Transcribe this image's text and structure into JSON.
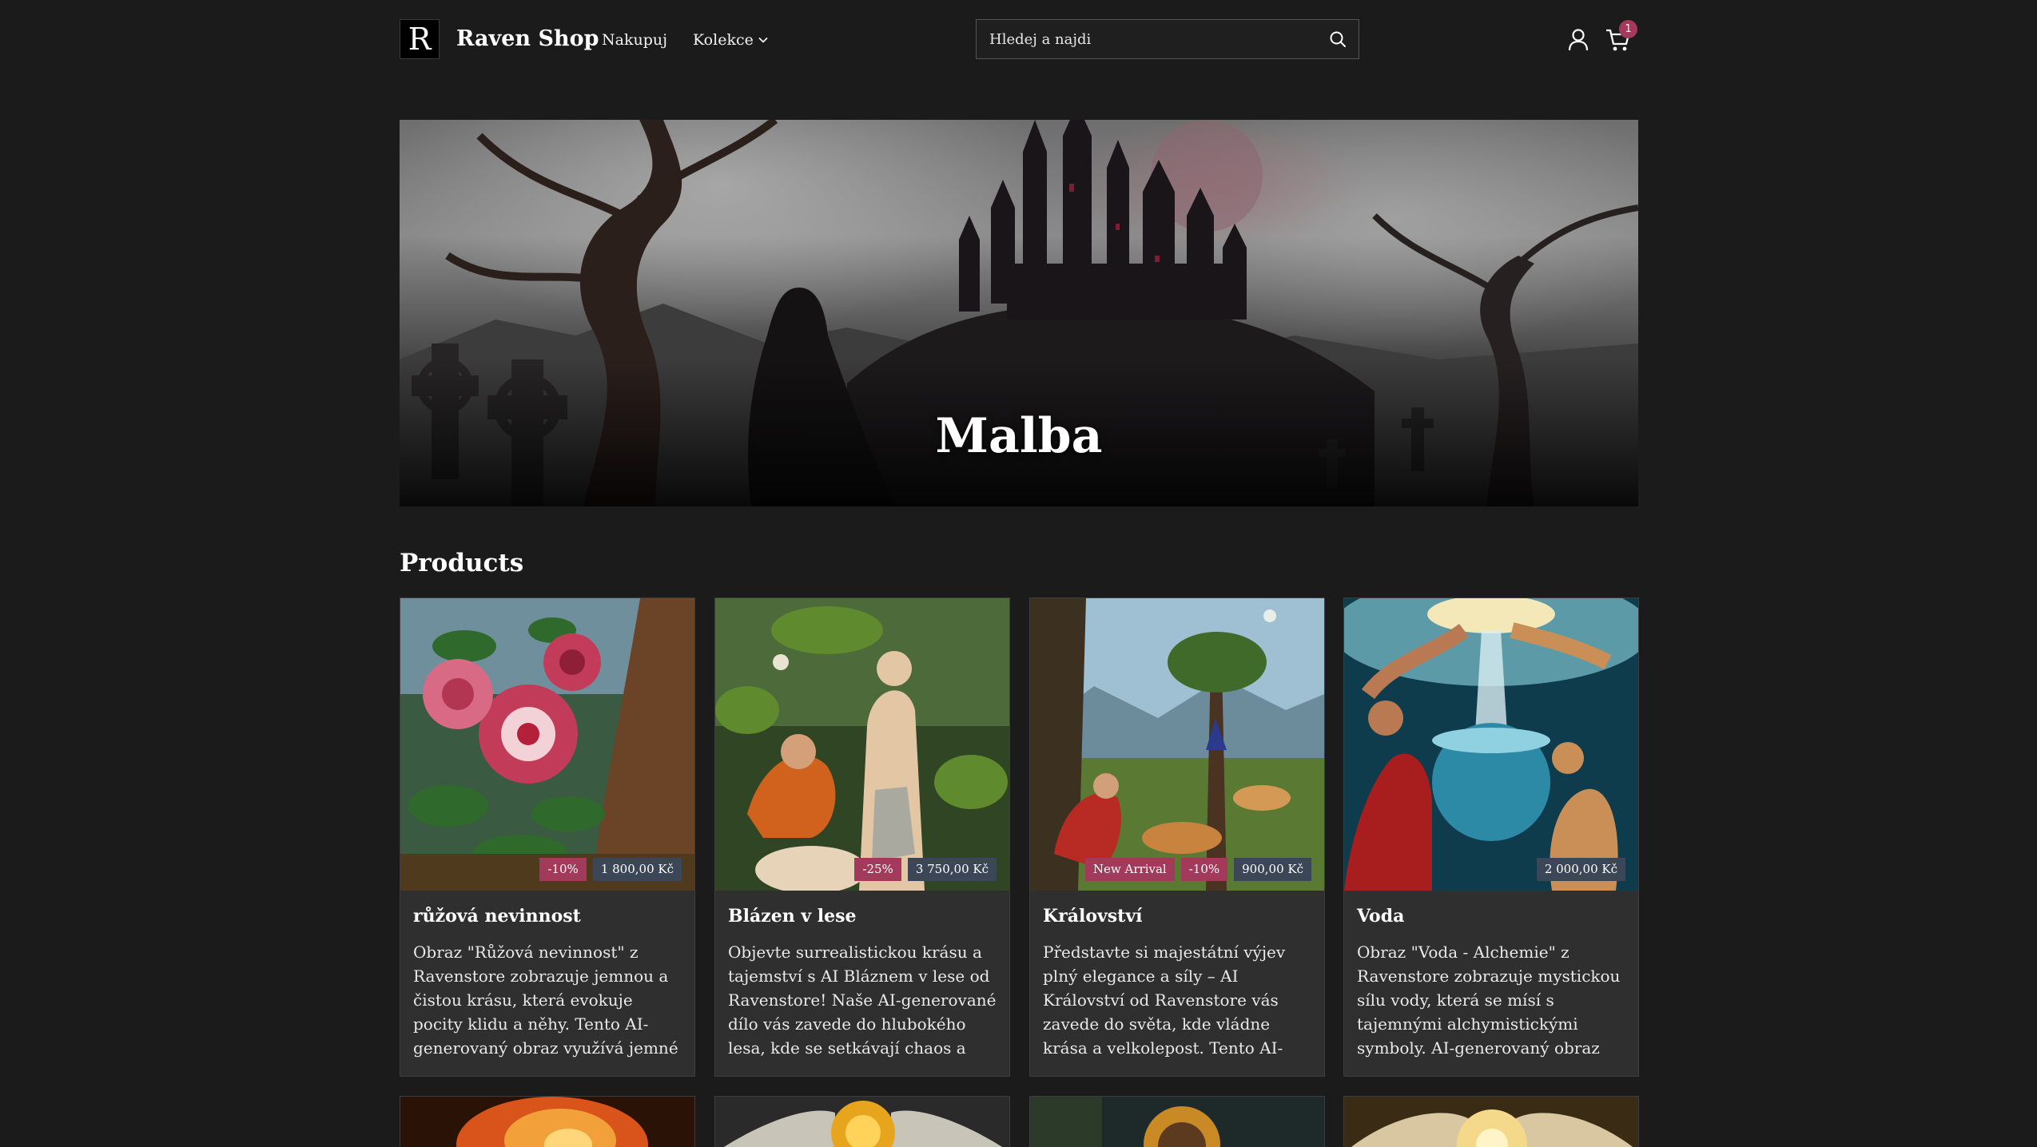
{
  "header": {
    "logo_letter": "R",
    "brand": "Raven Shop",
    "nav": {
      "shop": "Nakupuj",
      "collections": "Kolekce"
    },
    "search_placeholder": "Hledej a najdi",
    "cart_count": "1",
    "icons": [
      "search-icon",
      "account-icon",
      "cart-icon",
      "chevron-down-icon"
    ]
  },
  "hero": {
    "title": "Malba"
  },
  "products": {
    "heading": "Products",
    "items": [
      {
        "name": "růžová nevinnost",
        "discount": "-10%",
        "price": "1 800,00 Kč",
        "description": "Obraz \"Růžová nevinnost\" z Ravenstore zobrazuje jemnou a čistou krásu, která evokuje pocity klidu a něhy. Tento AI-generovaný obraz využívá jemné odstíny růžov..."
      },
      {
        "name": "Blázen v lese",
        "discount": "-25%",
        "price": "3 750,00 Kč",
        "description": "Objevte surrealistickou krásu a tajemství s AI Bláznem v lese od Ravenstore! Naše AI-generované dílo vás zavede do hlubokého lesa, kde se setkávají chaos a klid v..."
      },
      {
        "name": "Království",
        "tag": "New Arrival",
        "discount": "-10%",
        "price": "900,00 Kč",
        "description": "Představte si majestátní výjev plný elegance a síly – AI Království od Ravenstore vás zavede do světa, kde vládne krása a velkolepost. Tento AI-generovaný obraz zachycuje..."
      },
      {
        "name": "Voda",
        "price": "2 000,00 Kč",
        "description": "Obraz \"Voda - Alchemie\" z Ravenstore zobrazuje mystickou sílu vody, která se mísí s tajemnými alchymistickými symboly. AI-generovaný obraz kombinuje fluid..."
      }
    ]
  },
  "colors": {
    "background": "#1b1b1b",
    "card": "#2f2f2f",
    "sale_badge": "#a33a5c",
    "price_badge": "#3b4656"
  }
}
